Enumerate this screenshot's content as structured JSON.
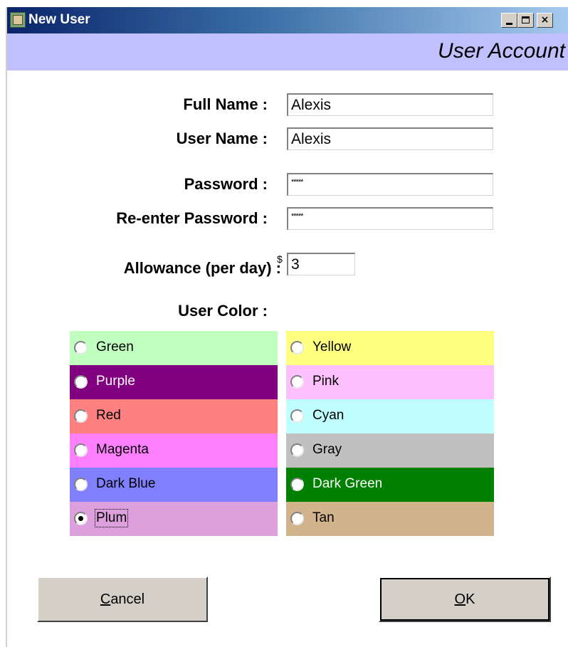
{
  "window": {
    "title": "New User",
    "controls": {
      "minimize": "_",
      "maximize": "",
      "close": "×"
    }
  },
  "header": {
    "title": "User Account"
  },
  "form": {
    "full_name_label": "Full Name :",
    "full_name_value": "Alexis",
    "user_name_label": "User Name :",
    "user_name_value": "Alexis",
    "password_label": "Password :",
    "password_value": "*****",
    "reenter_password_label": "Re-enter Password :",
    "reenter_password_value": "*****",
    "allowance_label": "Allowance (per day) :",
    "currency_symbol": "$",
    "allowance_value": "3",
    "user_color_label": "User Color :"
  },
  "colors": {
    "selected": "Plum",
    "left": [
      {
        "label": "Green",
        "bg": "#c0ffc0",
        "text": "#000000"
      },
      {
        "label": "Purple",
        "bg": "#800080",
        "text": "#ffffff"
      },
      {
        "label": "Red",
        "bg": "#ff8080",
        "text": "#000000"
      },
      {
        "label": "Magenta",
        "bg": "#ff80ff",
        "text": "#000000"
      },
      {
        "label": "Dark Blue",
        "bg": "#8080ff",
        "text": "#000000"
      },
      {
        "label": "Plum",
        "bg": "#dda0dd",
        "text": "#000000"
      }
    ],
    "right": [
      {
        "label": "Yellow",
        "bg": "#ffff80",
        "text": "#000000"
      },
      {
        "label": "Pink",
        "bg": "#ffc0ff",
        "text": "#000000"
      },
      {
        "label": "Cyan",
        "bg": "#c0ffff",
        "text": "#000000"
      },
      {
        "label": "Gray",
        "bg": "#c0c0c0",
        "text": "#000000"
      },
      {
        "label": "Dark Green",
        "bg": "#008000",
        "text": "#ffffff"
      },
      {
        "label": "Tan",
        "bg": "#d2b48c",
        "text": "#000000"
      }
    ]
  },
  "buttons": {
    "cancel_mnemonic": "C",
    "cancel_rest": "ancel",
    "ok_mnemonic": "O",
    "ok_rest": "K"
  }
}
